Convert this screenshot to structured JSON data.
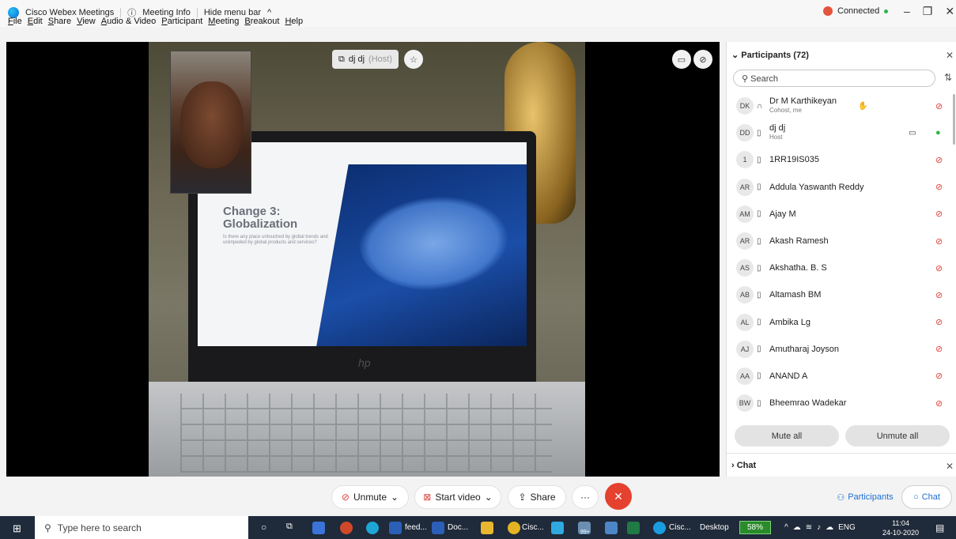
{
  "titlebar": {
    "app_name": "Cisco Webex Meetings",
    "meeting_info": "Meeting Info",
    "hide_menu": "Hide menu bar",
    "connection_status": "Connected"
  },
  "menu": [
    "File",
    "Edit",
    "Share",
    "View",
    "Audio & Video",
    "Participant",
    "Meeting",
    "Breakout",
    "Help"
  ],
  "stage": {
    "name_tag": "dj dj",
    "host_tag": "(Host)",
    "slide_title_line1": "Change 3:",
    "slide_title_line2": "Globalization",
    "slide_text": "Is there any place untouched by global trends and unimpeded by global products and services?",
    "laptop_logo": "hp"
  },
  "participants": {
    "header": "Participants (72)",
    "search_placeholder": "Search",
    "list": [
      {
        "initials": "DK",
        "name": "Dr M Karthikeyan",
        "sub": "Cohost, me",
        "mic": "muted",
        "hand": true
      },
      {
        "initials": "DD",
        "name": "dj dj",
        "sub": "Host",
        "mic": "on",
        "camera": true
      },
      {
        "initials": "1",
        "name": "1RR19IS035",
        "mic": "muted"
      },
      {
        "initials": "AR",
        "name": "Addula Yaswanth Reddy",
        "mic": "muted"
      },
      {
        "initials": "AM",
        "name": "Ajay M",
        "mic": "muted"
      },
      {
        "initials": "AR",
        "name": "Akash Ramesh",
        "mic": "muted"
      },
      {
        "initials": "AS",
        "name": "Akshatha. B. S",
        "mic": "muted"
      },
      {
        "initials": "AB",
        "name": "Altamash BM",
        "mic": "muted"
      },
      {
        "initials": "AL",
        "name": "Ambika Lg",
        "mic": "muted"
      },
      {
        "initials": "AJ",
        "name": "Amutharaj Joyson",
        "mic": "muted"
      },
      {
        "initials": "AA",
        "name": "ANAND A",
        "mic": "muted"
      },
      {
        "initials": "BW",
        "name": "Bheemrao Wadekar",
        "mic": "muted"
      }
    ],
    "mute_all": "Mute all",
    "unmute_all": "Unmute all"
  },
  "chat_section": {
    "label": "Chat"
  },
  "controls": {
    "unmute": "Unmute",
    "start_video": "Start video",
    "share": "Share",
    "more": "···",
    "participants": "Participants",
    "chat": "Chat"
  },
  "taskbar": {
    "search_placeholder": "Type here to search",
    "apps": [
      "feed...",
      "Doc...",
      "Cisc...",
      "Cisc..."
    ],
    "badge": "99+",
    "desktop": "Desktop",
    "battery": "58%",
    "lang": "ENG",
    "time": "11:04",
    "date": "24-10-2020"
  },
  "colors": {
    "mute_red": "#e0433c",
    "mic_green": "#2db54c",
    "end_red": "#e4412f",
    "accent_blue": "#1f6fd1"
  }
}
